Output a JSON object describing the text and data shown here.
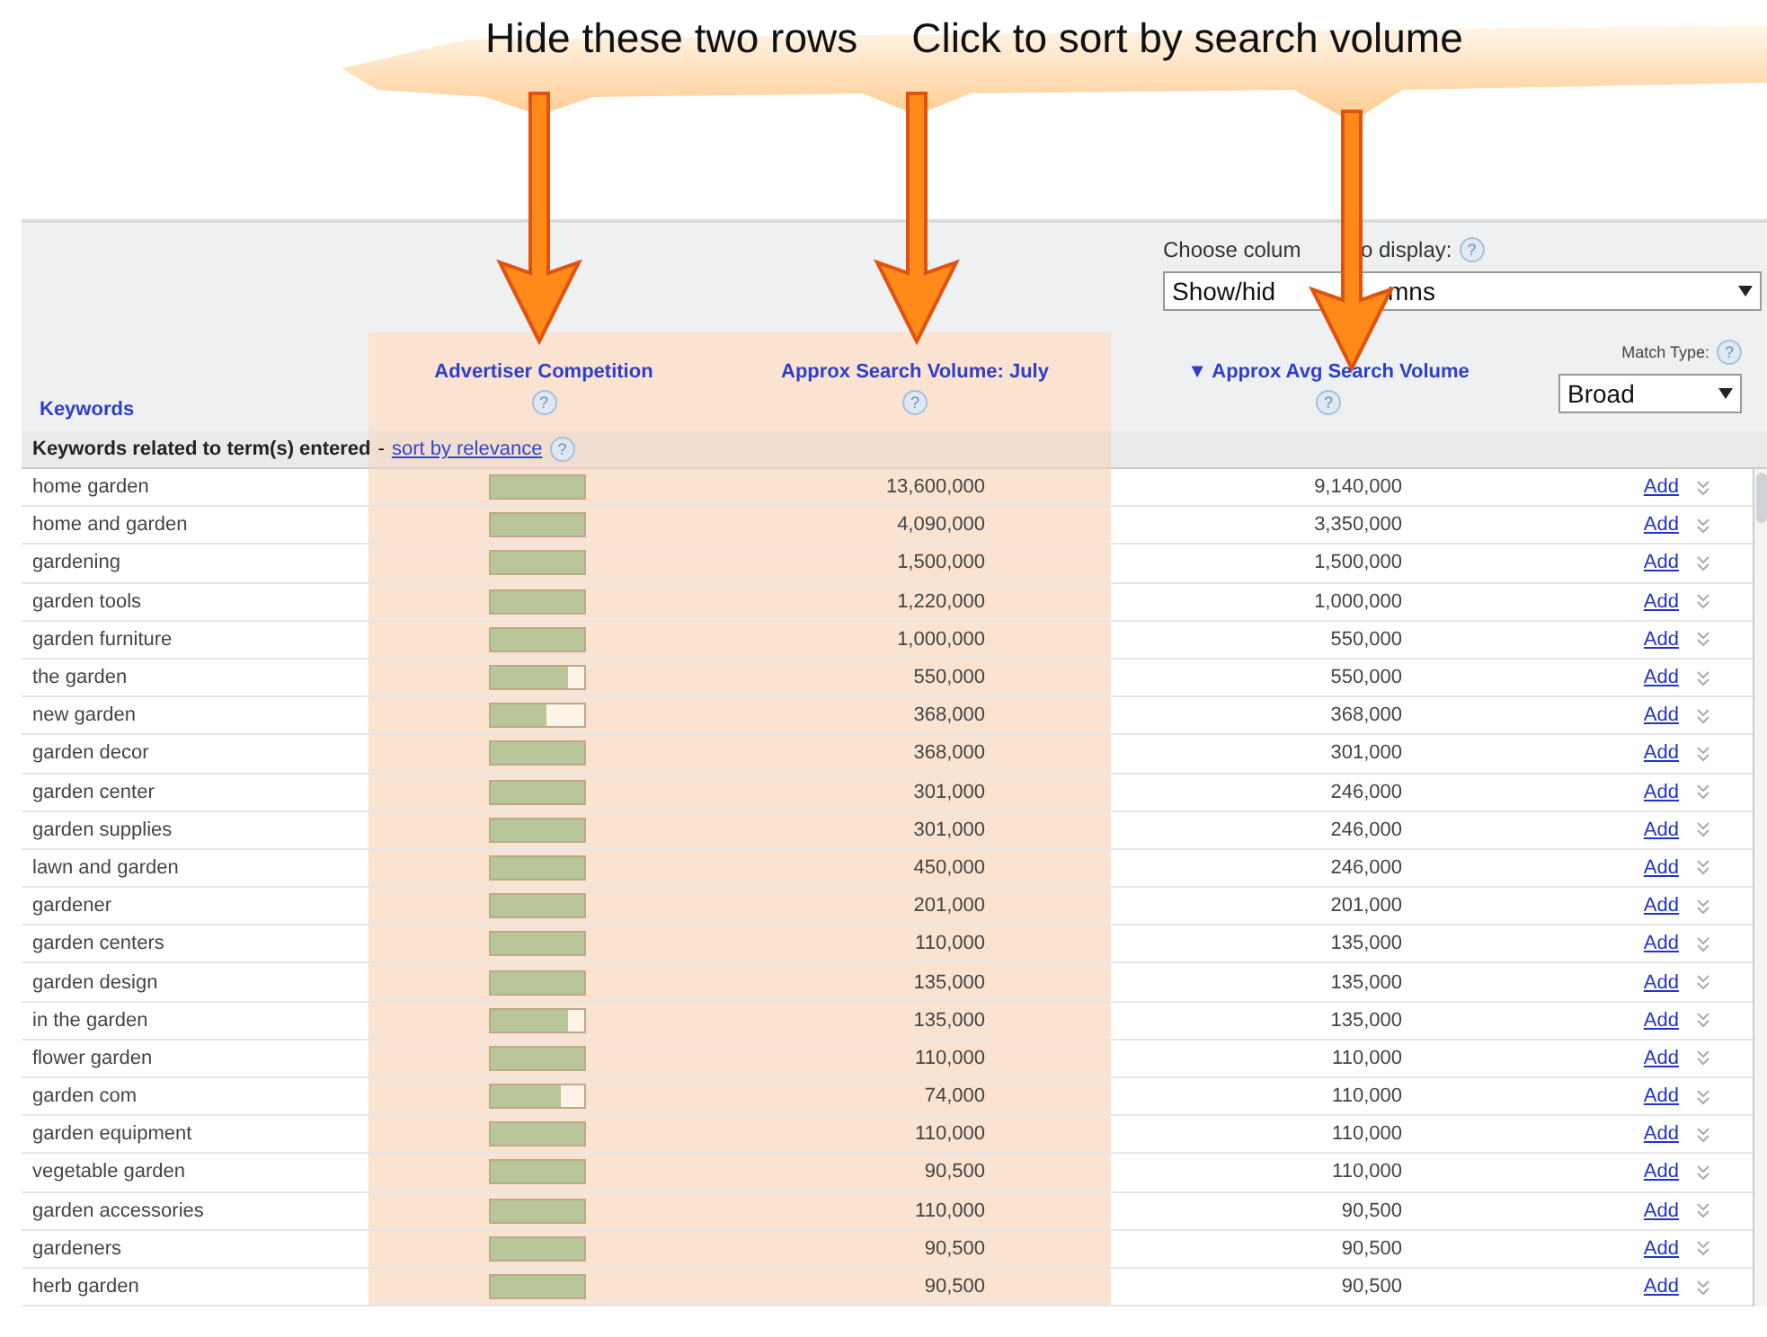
{
  "callouts": [
    "Hide these two rows",
    "Click to sort by search volume"
  ],
  "columns_chooser": {
    "label_parts": [
      "Choose colum",
      "o display:"
    ],
    "help": "?",
    "value_parts": [
      "Show/hid",
      "mns"
    ]
  },
  "columns": [
    {
      "kind": "keyword",
      "label": "Keywords"
    },
    {
      "kind": "meter",
      "label": "Advertiser Competition",
      "help": "?"
    },
    {
      "kind": "number",
      "label": "Approx Search Volume: July",
      "help": "?"
    },
    {
      "kind": "sorted",
      "label": "Approx Avg Search Volume",
      "sort_indicator": "▼",
      "help": "?"
    },
    {
      "kind": "match",
      "label": "Match Type:",
      "help": "?",
      "value": "Broad"
    }
  ],
  "section": {
    "label": "Keywords related to term(s) entered",
    "separator": "-",
    "link": "sort by relevance",
    "help": "?"
  },
  "rows": [
    {
      "keyword": "home garden",
      "level": 1,
      "july": "13,600,000",
      "avg": "9,140,000",
      "action": "Add"
    },
    {
      "keyword": "home and garden",
      "level": 1,
      "july": "4,090,000",
      "avg": "3,350,000",
      "action": "Add"
    },
    {
      "keyword": "gardening",
      "level": 1,
      "july": "1,500,000",
      "avg": "1,500,000",
      "action": "Add"
    },
    {
      "keyword": "garden tools",
      "level": 1,
      "july": "1,220,000",
      "avg": "1,000,000",
      "action": "Add"
    },
    {
      "keyword": "garden furniture",
      "level": 1,
      "july": "1,000,000",
      "avg": "550,000",
      "action": "Add"
    },
    {
      "keyword": "the garden",
      "level": 0.82,
      "july": "550,000",
      "avg": "550,000",
      "action": "Add"
    },
    {
      "keyword": "new garden",
      "level": 0.6,
      "july": "368,000",
      "avg": "368,000",
      "action": "Add"
    },
    {
      "keyword": "garden decor",
      "level": 1,
      "july": "368,000",
      "avg": "301,000",
      "action": "Add"
    },
    {
      "keyword": "garden center",
      "level": 1,
      "july": "301,000",
      "avg": "246,000",
      "action": "Add"
    },
    {
      "keyword": "garden supplies",
      "level": 1,
      "july": "301,000",
      "avg": "246,000",
      "action": "Add"
    },
    {
      "keyword": "lawn and garden",
      "level": 1,
      "july": "450,000",
      "avg": "246,000",
      "action": "Add"
    },
    {
      "keyword": "gardener",
      "level": 1,
      "july": "201,000",
      "avg": "201,000",
      "action": "Add"
    },
    {
      "keyword": "garden centers",
      "level": 1,
      "july": "110,000",
      "avg": "135,000",
      "action": "Add"
    },
    {
      "keyword": "garden design",
      "level": 1,
      "july": "135,000",
      "avg": "135,000",
      "action": "Add"
    },
    {
      "keyword": "in the garden",
      "level": 0.82,
      "july": "135,000",
      "avg": "135,000",
      "action": "Add"
    },
    {
      "keyword": "flower garden",
      "level": 1,
      "july": "110,000",
      "avg": "110,000",
      "action": "Add"
    },
    {
      "keyword": "garden com",
      "level": 0.75,
      "july": "74,000",
      "avg": "110,000",
      "action": "Add"
    },
    {
      "keyword": "garden equipment",
      "level": 1,
      "july": "110,000",
      "avg": "110,000",
      "action": "Add"
    },
    {
      "keyword": "vegetable garden",
      "level": 1,
      "july": "90,500",
      "avg": "110,000",
      "action": "Add"
    },
    {
      "keyword": "garden accessories",
      "level": 1,
      "july": "110,000",
      "avg": "90,500",
      "action": "Add"
    },
    {
      "keyword": "gardeners",
      "level": 1,
      "july": "90,500",
      "avg": "90,500",
      "action": "Add"
    },
    {
      "keyword": "herb garden",
      "level": 1,
      "july": "90,500",
      "avg": "90,500",
      "action": "Add"
    }
  ]
}
